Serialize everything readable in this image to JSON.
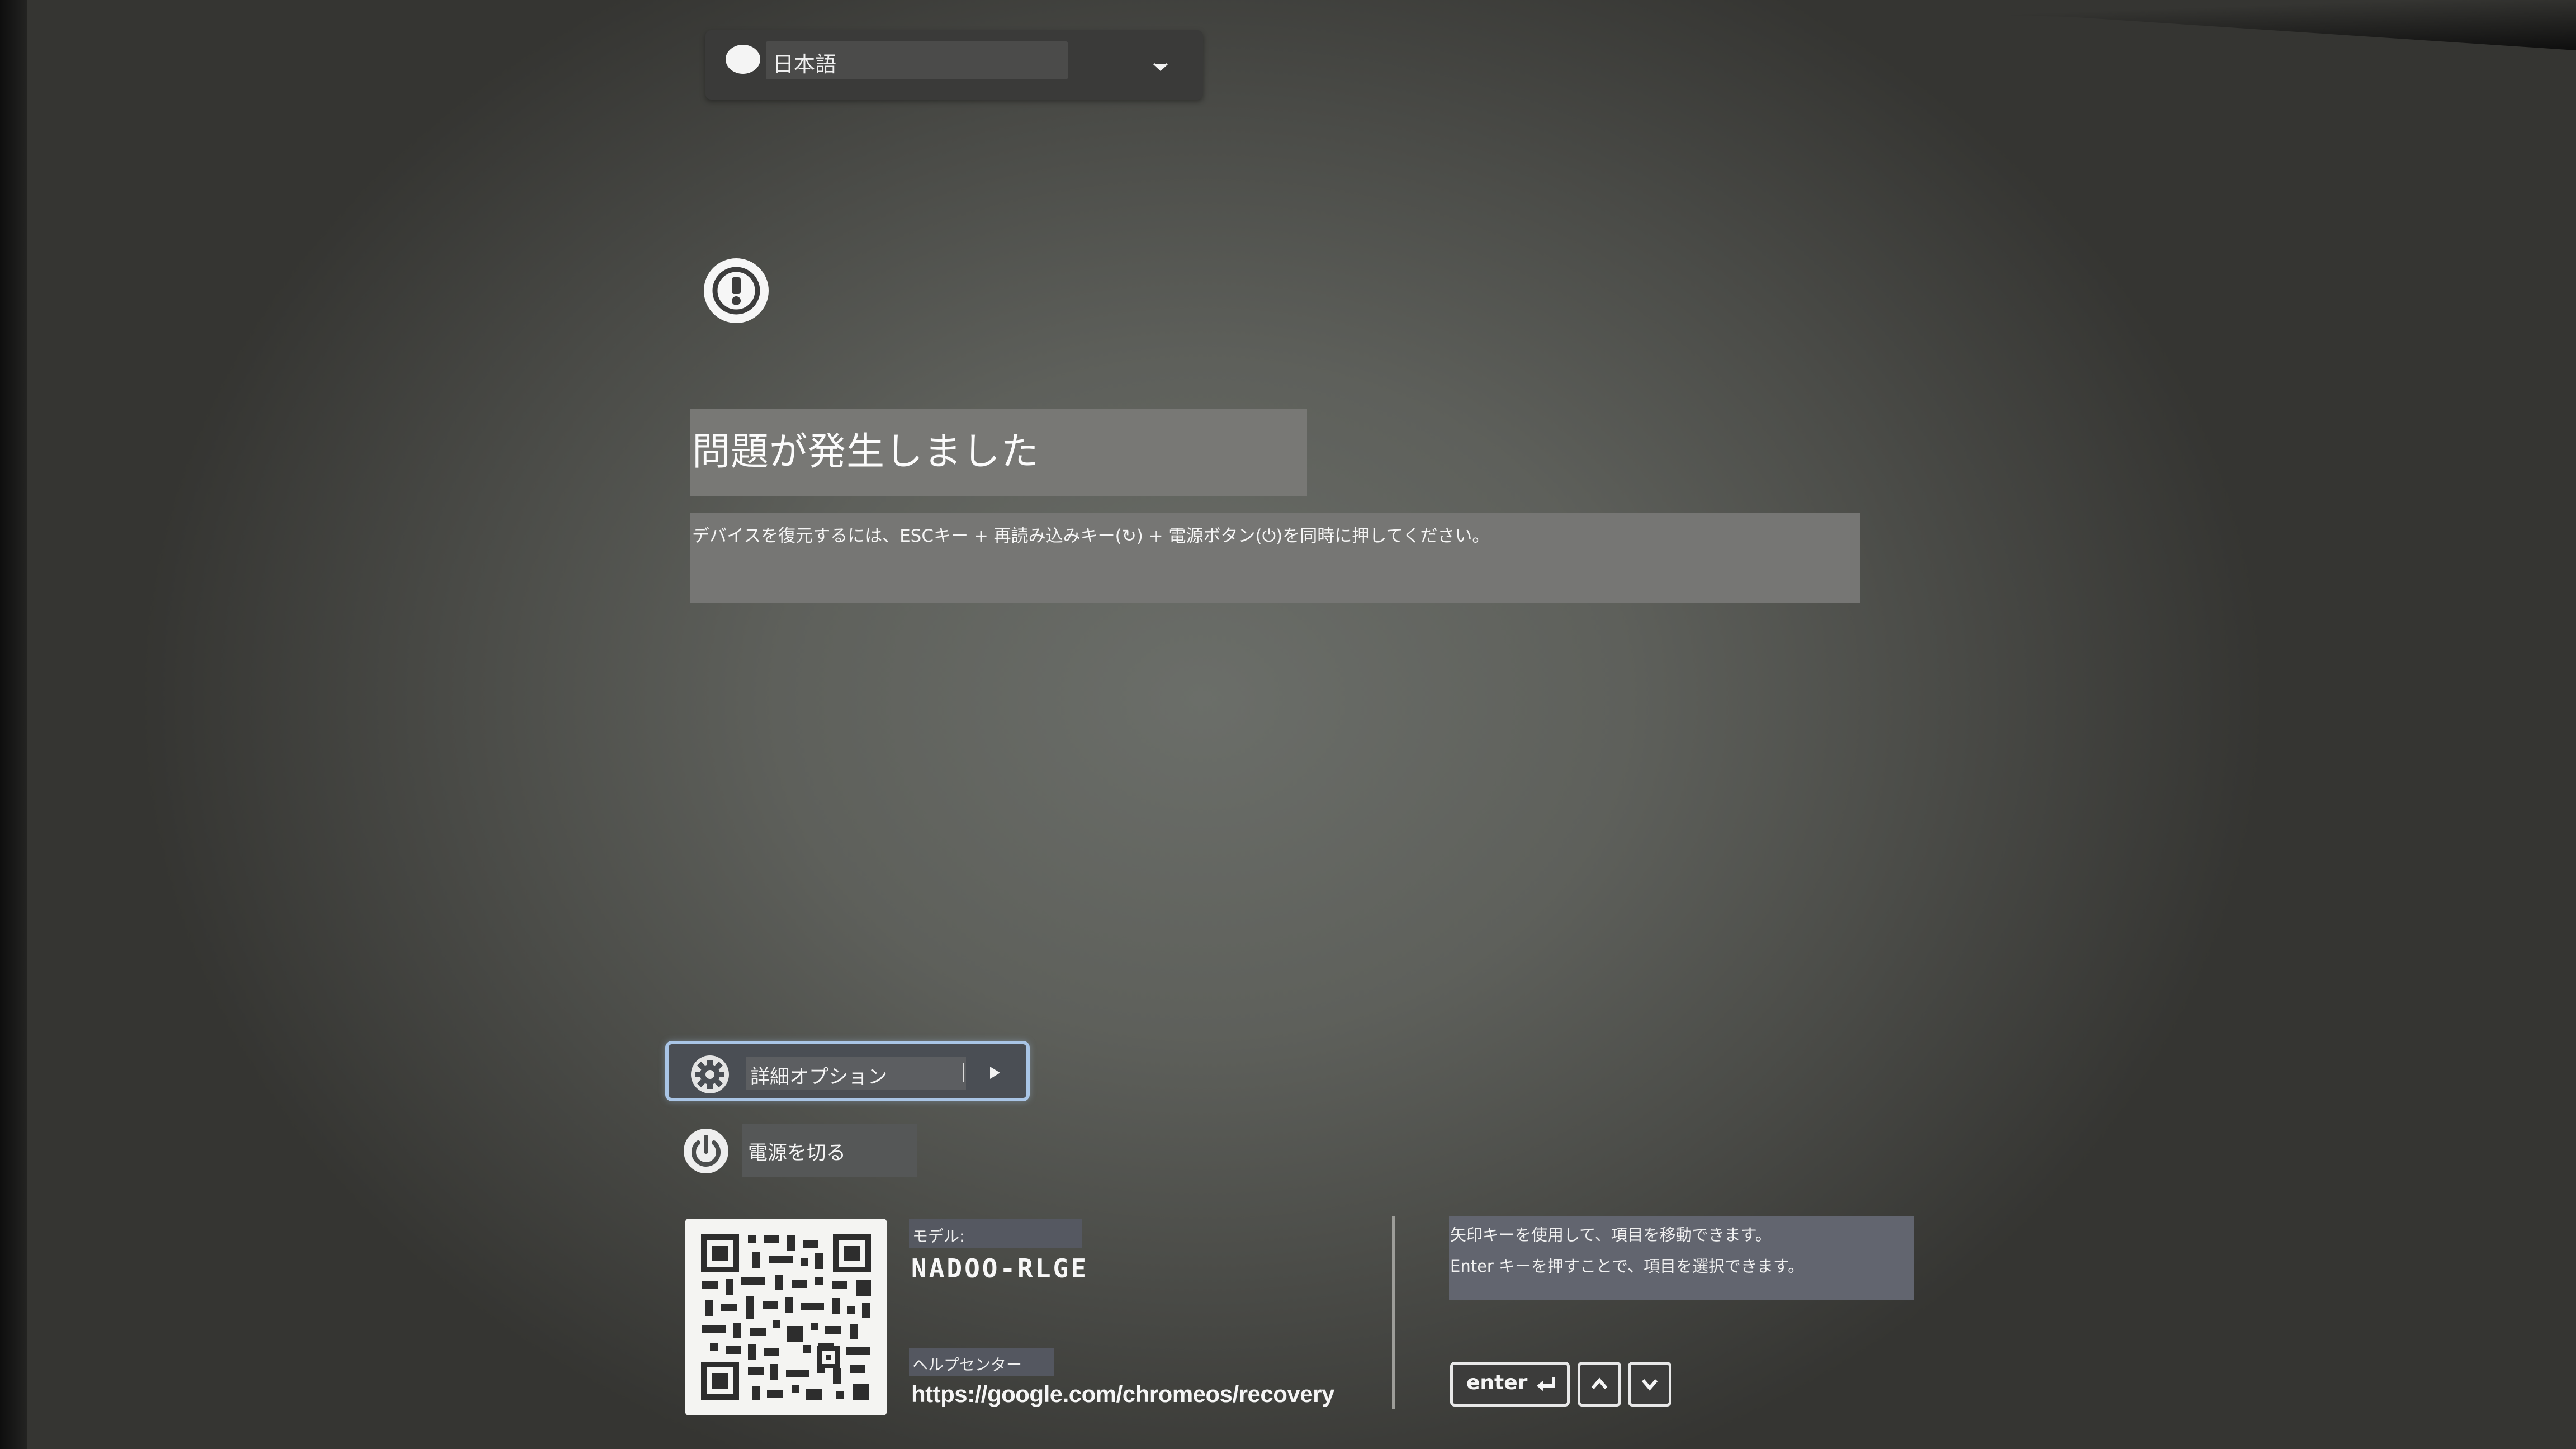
{
  "language_selector": {
    "selected": "日本語",
    "icon": "globe-icon",
    "chevron_icon": "chevron-down-icon"
  },
  "alert": {
    "icon": "exclamation-circle-icon"
  },
  "main": {
    "title": "問題が発生しました",
    "description": "デバイスを復元するには、ESCキー + 再読み込みキー(↻) + 電源ボタン(⏻)を同時に押してください。"
  },
  "actions": {
    "advanced_options_label": "詳細オプション",
    "advanced_options_icon": "gear-icon",
    "power_off_label": "電源を切る",
    "power_off_icon": "power-icon"
  },
  "footer": {
    "model_caption": "モデル:",
    "model_value": "NADOO-RLGE",
    "help_caption": "ヘルプセンター",
    "help_url": "https://google.com/chromeos/recovery",
    "nav_hint": "矢印キーを使用して、項目を移動できます。",
    "select_hint": "Enter キーを押すことで、項目を選択できます。",
    "keys": {
      "enter_label": "enter",
      "up_icon": "chevron-up-icon",
      "down_icon": "chevron-down-icon"
    }
  },
  "colors": {
    "focus_ring": "#a9c5e6",
    "background": "#5e605b"
  }
}
